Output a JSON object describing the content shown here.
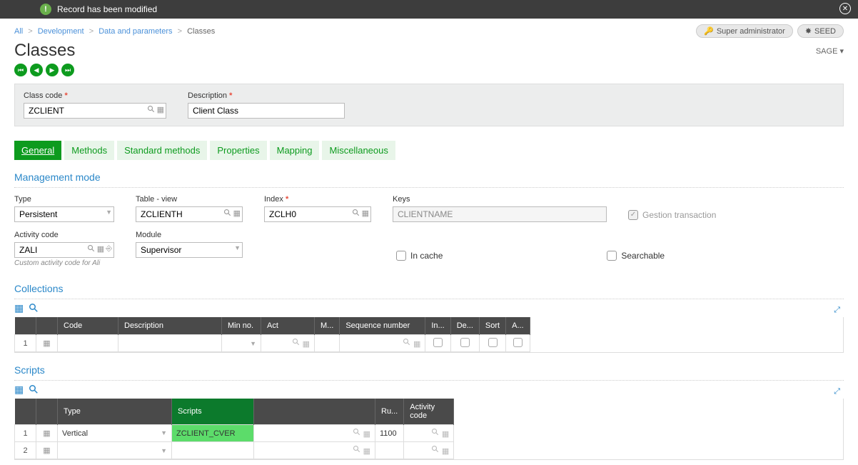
{
  "notification": {
    "text": "Record has been modified"
  },
  "breadcrumb": {
    "all": "All",
    "dev": "Development",
    "dp": "Data and parameters",
    "cls": "Classes"
  },
  "badges": {
    "admin": "Super administrator",
    "seed": "SEED"
  },
  "page_title": "Classes",
  "sage_label": "SAGE ▾",
  "top_form": {
    "class_code_label": "Class code",
    "class_code": "ZCLIENT",
    "desc_label": "Description",
    "desc": "Client Class"
  },
  "tab_labels": [
    "General",
    "Methods",
    "Standard methods",
    "Properties",
    "Mapping",
    "Miscellaneous"
  ],
  "mgmt": {
    "title": "Management mode",
    "type_label": "Type",
    "type": "Persistent",
    "table_label": "Table - view",
    "table": "ZCLIENTH",
    "index_label": "Index",
    "index": "ZCLH0",
    "keys_label": "Keys",
    "keys": "CLIENTNAME",
    "gestion": "Gestion transaction",
    "activity_label": "Activity code",
    "activity": "ZALI",
    "activity_hint": "Custom activity code for Ali",
    "module_label": "Module",
    "module": "Supervisor",
    "incache": "In cache",
    "searchable": "Searchable"
  },
  "collections": {
    "title": "Collections",
    "headers": {
      "code": "Code",
      "desc": "Description",
      "min": "Min no.",
      "act": "Act",
      "m": "M...",
      "seq": "Sequence number",
      "in": "In...",
      "de": "De...",
      "sort": "Sort",
      "a": "A..."
    },
    "rows": [
      {
        "num": "1"
      }
    ]
  },
  "scripts": {
    "title": "Scripts",
    "headers": {
      "type": "Type",
      "scripts": "Scripts",
      "ru": "Ru...",
      "activity": "Activity code"
    },
    "rows": [
      {
        "num": "1",
        "type": "Vertical",
        "scripts": "ZCLIENT_CVER",
        "ru": "1100",
        "activity": ""
      },
      {
        "num": "2",
        "type": "",
        "scripts": "",
        "ru": "",
        "activity": ""
      }
    ]
  }
}
